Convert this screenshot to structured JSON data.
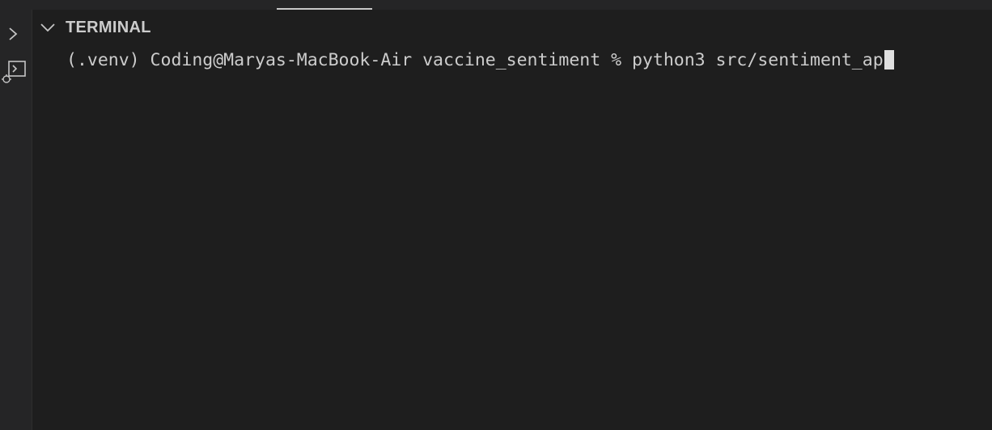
{
  "panel": {
    "title": "TERMINAL"
  },
  "terminal": {
    "prompt": "(.venv) Coding@Maryas-MacBook-Air vaccine_sentiment % ",
    "command": "python3 src/sentiment_ap"
  },
  "icons": {
    "expand": "chevron-right-icon",
    "collapse": "chevron-down-icon",
    "terminal_side": "terminal-debug-icon"
  },
  "colors": {
    "background": "#1e1e1e",
    "sidebar": "#252526",
    "text": "#cccccc",
    "cursor": "#e0e0e0"
  }
}
